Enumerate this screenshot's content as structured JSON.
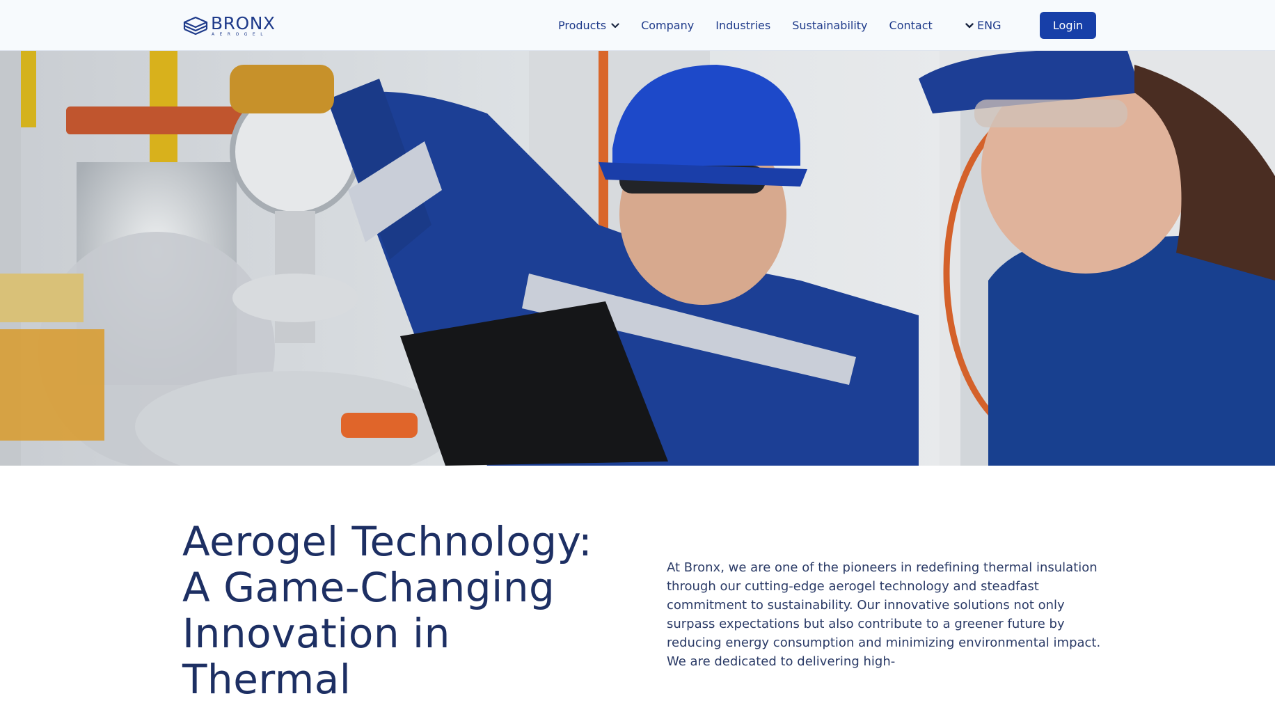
{
  "brand": {
    "name": "BRONX",
    "tagline": "AEROGEL",
    "logo_icon": "aerogel-layers-icon",
    "color": "#1e3a8a"
  },
  "nav": {
    "items": [
      {
        "label": "Products",
        "has_dropdown": true,
        "icon": "chevron-down-icon"
      },
      {
        "label": "Company"
      },
      {
        "label": "Industries"
      },
      {
        "label": "Sustainability"
      },
      {
        "label": "Contact"
      }
    ],
    "language": {
      "label": "ENG",
      "icon": "chevron-down-icon"
    },
    "login_label": "Login",
    "login_color": "#173fa8"
  },
  "hero": {
    "image_description_icon": "industrial-workers-photo"
  },
  "main": {
    "headline": "Aerogel Technology: A Game-Changing Innovation in Thermal",
    "intro": "At Bronx, we are one of the pioneers in redefining thermal insulation through our cutting-edge aerogel technology and steadfast commitment to sustainability. Our innovative solutions not only surpass expectations but also contribute to a greener future by reducing energy consumption and minimizing environmental impact. We are dedicated to delivering high-"
  }
}
